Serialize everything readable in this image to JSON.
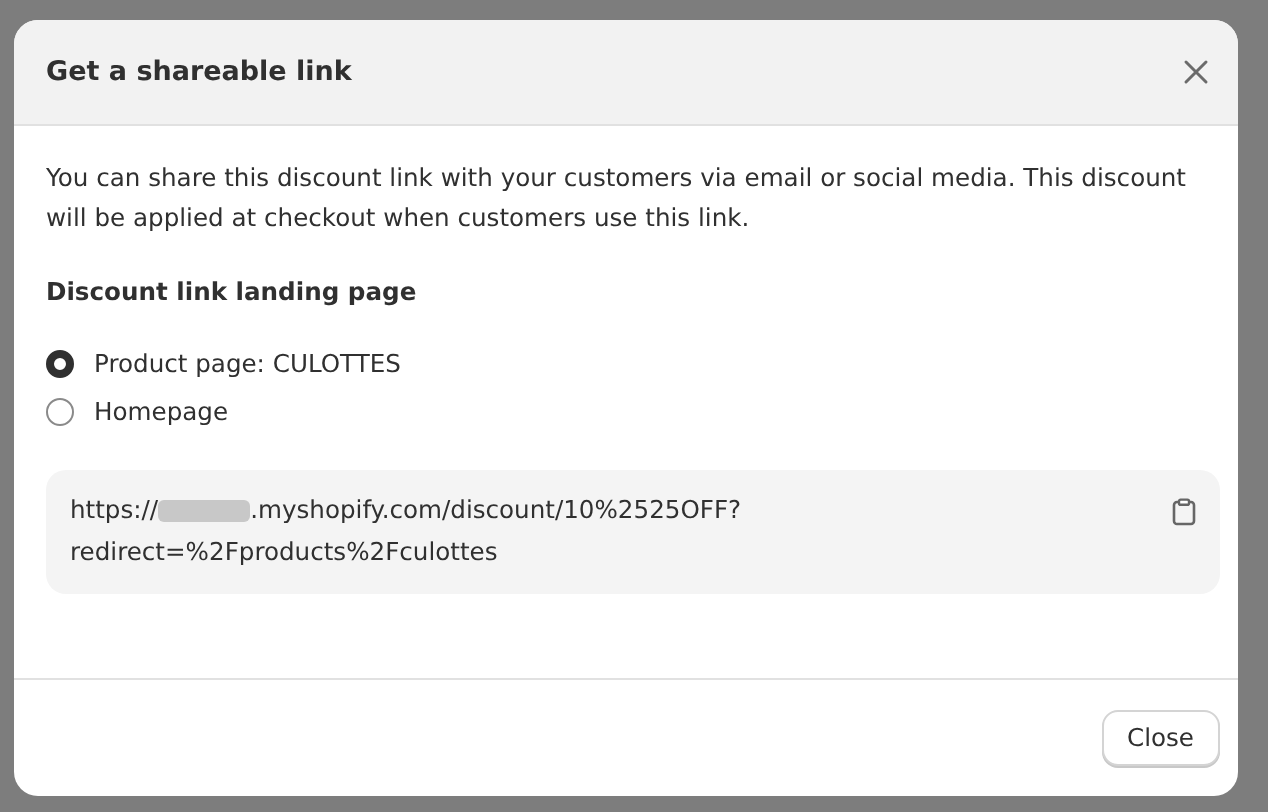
{
  "dialog": {
    "title": "Get a shareable link",
    "description": "You can share this discount link with your customers via email or social media. This discount will be applied at checkout when customers use this link.",
    "section_heading": "Discount link landing page",
    "options": [
      {
        "label": "Product page: CULOTTES",
        "selected": true
      },
      {
        "label": "Homepage",
        "selected": false
      }
    ],
    "link": {
      "prefix": "https://",
      "redacted": true,
      "line1_rest": ".myshopify.com/discount/10%2525OFF?",
      "line2": "redirect=%2Fproducts%2Fculottes"
    },
    "buttons": [
      "Close"
    ]
  }
}
